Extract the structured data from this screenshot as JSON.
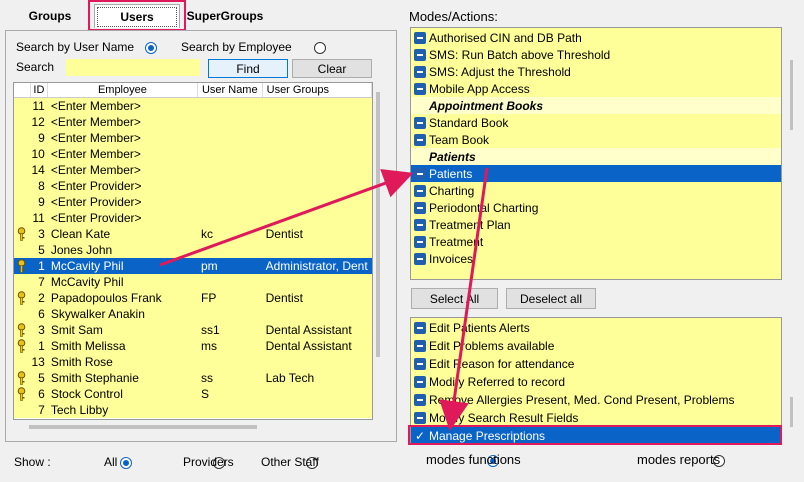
{
  "tabs": {
    "groups": "Groups",
    "users": "Users",
    "supergroups": "SuperGroups"
  },
  "search": {
    "by_user_name": "Search by User Name",
    "by_employee": "Search by Employee",
    "label": "Search",
    "value": "",
    "find": "Find",
    "clear": "Clear"
  },
  "grid": {
    "headers": [
      "ID",
      "Employee",
      "User Name",
      "User Groups"
    ],
    "rows": [
      {
        "key": false,
        "id": "11",
        "employee": "<Enter Member>",
        "user": "",
        "groups": ""
      },
      {
        "key": false,
        "id": "12",
        "employee": "<Enter Member>",
        "user": "",
        "groups": ""
      },
      {
        "key": false,
        "id": "9",
        "employee": "<Enter Member>",
        "user": "",
        "groups": ""
      },
      {
        "key": false,
        "id": "10",
        "employee": "<Enter Member>",
        "user": "",
        "groups": ""
      },
      {
        "key": false,
        "id": "14",
        "employee": "<Enter Member>",
        "user": "",
        "groups": ""
      },
      {
        "key": false,
        "id": "8",
        "employee": "<Enter Provider>",
        "user": "",
        "groups": ""
      },
      {
        "key": false,
        "id": "9",
        "employee": "<Enter Provider>",
        "user": "",
        "groups": ""
      },
      {
        "key": false,
        "id": "11",
        "employee": "<Enter Provider>",
        "user": "",
        "groups": ""
      },
      {
        "key": true,
        "id": "3",
        "employee": "Clean Kate",
        "user": "kc",
        "groups": "Dentist"
      },
      {
        "key": false,
        "id": "5",
        "employee": "Jones John",
        "user": "",
        "groups": ""
      },
      {
        "key": true,
        "id": "1",
        "employee": "McCavity Phil",
        "user": "pm",
        "groups": "Administrator, Dent",
        "selected": true
      },
      {
        "key": false,
        "id": "7",
        "employee": "McCavity Phil",
        "user": "",
        "groups": ""
      },
      {
        "key": true,
        "id": "2",
        "employee": "Papadopoulos Frank",
        "user": "FP",
        "groups": "Dentist"
      },
      {
        "key": false,
        "id": "6",
        "employee": "Skywalker Anakin",
        "user": "",
        "groups": ""
      },
      {
        "key": true,
        "id": "3",
        "employee": "Smit Sam",
        "user": "ss1",
        "groups": "Dental Assistant"
      },
      {
        "key": true,
        "id": "1",
        "employee": "Smith Melissa",
        "user": "ms",
        "groups": "Dental Assistant"
      },
      {
        "key": false,
        "id": "13",
        "employee": "Smith Rose",
        "user": "",
        "groups": ""
      },
      {
        "key": true,
        "id": "5",
        "employee": "Smith Stephanie",
        "user": "ss",
        "groups": "Lab Tech"
      },
      {
        "key": true,
        "id": "6",
        "employee": "Stock  Control",
        "user": "S",
        "groups": ""
      },
      {
        "key": false,
        "id": "7",
        "employee": "Tech Libby",
        "user": "",
        "groups": ""
      }
    ]
  },
  "show": {
    "label": "Show :",
    "all": "All",
    "providers": "Providers",
    "other": "Other Staff"
  },
  "modes": {
    "title": "Modes/Actions:",
    "items": [
      {
        "t": "item",
        "label": "Authorised CIN and DB Path"
      },
      {
        "t": "item",
        "label": "SMS: Run Batch above Threshold"
      },
      {
        "t": "item",
        "label": "SMS: Adjust the Threshold"
      },
      {
        "t": "item",
        "label": "Mobile App Access"
      },
      {
        "t": "hdr",
        "label": "Appointment Books"
      },
      {
        "t": "item",
        "label": "Standard Book"
      },
      {
        "t": "item",
        "label": "Team Book"
      },
      {
        "t": "hdr",
        "label": "Patients"
      },
      {
        "t": "item",
        "label": "Patients",
        "selected": true
      },
      {
        "t": "item",
        "label": "Charting"
      },
      {
        "t": "item",
        "label": "Periodontal Charting"
      },
      {
        "t": "item",
        "label": "Treatment Plan"
      },
      {
        "t": "item",
        "label": "Treatment"
      },
      {
        "t": "item",
        "label": "Invoices"
      }
    ],
    "select_all": "Select All",
    "deselect_all": "Deselect all"
  },
  "functions": {
    "items": [
      {
        "label": "Edit Patients Alerts",
        "mark": "minus"
      },
      {
        "label": "Edit Problems available",
        "mark": "minus"
      },
      {
        "label": "Edit Reason for attendance",
        "mark": "minus"
      },
      {
        "label": "Modify Referred to record",
        "mark": "minus"
      },
      {
        "label": "Remove Allergies Present, Med. Cond Present, Problems",
        "mark": "minus"
      },
      {
        "label": "Modify Search Result Fields",
        "mark": "minus"
      },
      {
        "label": "Manage Prescriptions",
        "mark": "check",
        "selected": true
      }
    ],
    "modes_functions": "modes functions",
    "modes_reports": "modes reports"
  },
  "colors": {
    "highlight": "#e0195a",
    "selection": "#0a64c8",
    "list_bg": "#ffff99"
  }
}
